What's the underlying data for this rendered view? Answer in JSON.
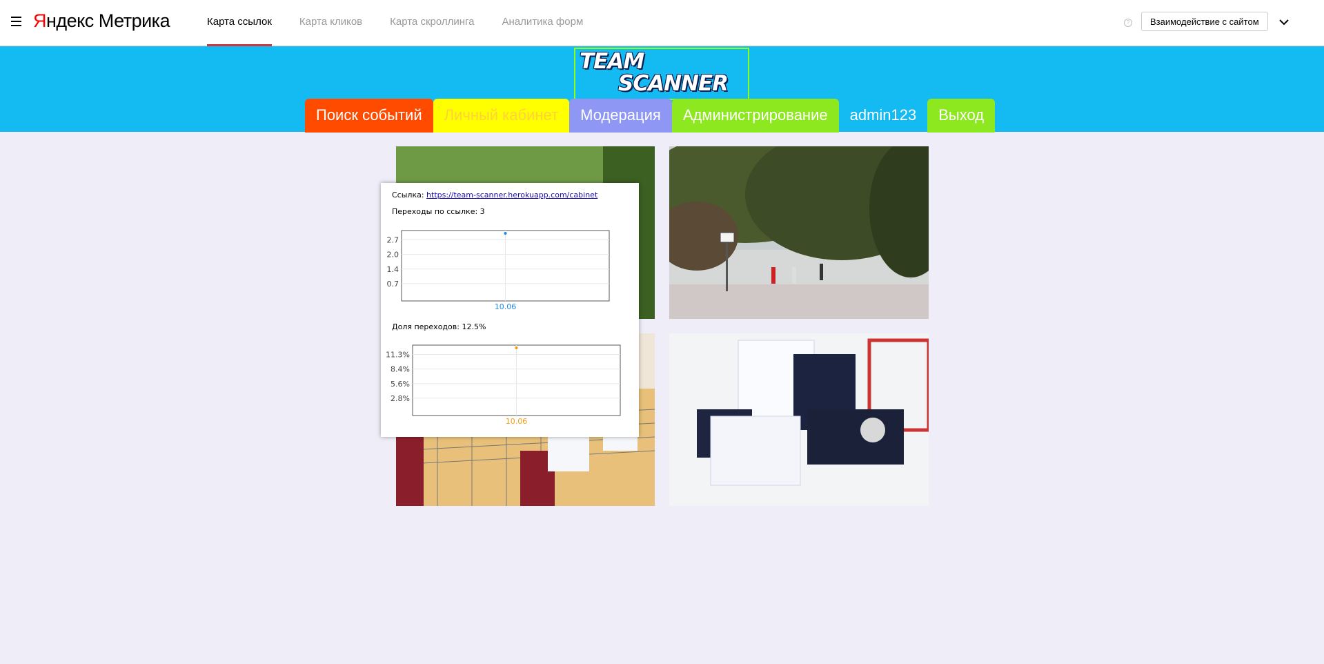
{
  "app": {
    "brand_red": "Я",
    "brand_rest": "ндекс Метрика",
    "tabs": [
      {
        "label": "Карта ссылок",
        "active": true
      },
      {
        "label": "Карта кликов",
        "active": false
      },
      {
        "label": "Карта скроллинга",
        "active": false
      },
      {
        "label": "Аналитика форм",
        "active": false
      }
    ],
    "help_icon": "?",
    "interaction_button": "Взаимодействие с сайтом",
    "accent_color": "#c73a44"
  },
  "site": {
    "logo_line1": "TEAM",
    "logo_line2": "SCANNER",
    "header_color": "#14bbf2",
    "nav": {
      "search": "Поиск событий",
      "cabinet": "Личный кабинет",
      "moderation": "Модерация",
      "administration": "Администрирование",
      "username": "admin123",
      "exit": "Выход"
    }
  },
  "popup": {
    "link_label": "Ссылка:",
    "link_url": "https://team-scanner.herokuapp.com/cabinet",
    "clicks_label": "Переходы по ссылке:",
    "clicks_value": "3",
    "share_label": "Доля переходов:",
    "share_value": "12.5%"
  },
  "chart_data": [
    {
      "type": "scatter",
      "categories": [
        "10.06"
      ],
      "values": [
        3
      ],
      "y_ticks": [
        "2.7",
        "2.0",
        "1.4",
        "0.7"
      ],
      "ylim": [
        0,
        3
      ],
      "grid": true,
      "color": "#1e88e5"
    },
    {
      "type": "scatter",
      "categories": [
        "10.06"
      ],
      "values": [
        12.5
      ],
      "y_ticks": [
        "11.3%",
        "8.4%",
        "5.6%",
        "2.8%"
      ],
      "ylim": [
        0,
        12.5
      ],
      "grid": true,
      "color": "#f39c12"
    }
  ]
}
